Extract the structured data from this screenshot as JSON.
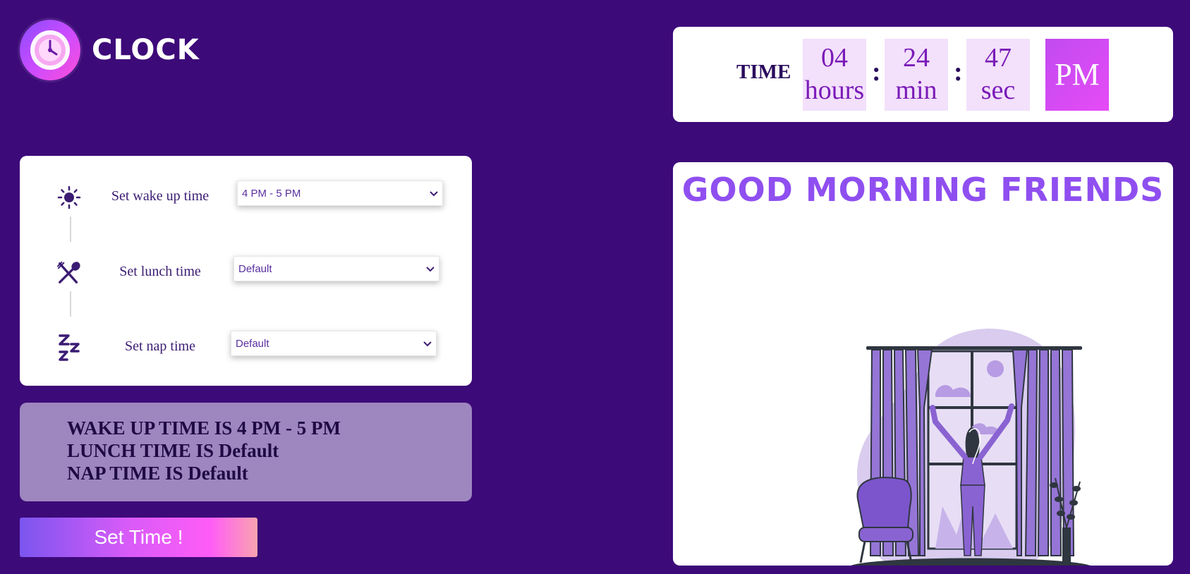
{
  "app": {
    "title": "CLOCK"
  },
  "time": {
    "label": "TIME",
    "hours": {
      "value": "04",
      "unit": "hours"
    },
    "minutes": {
      "value": "24",
      "unit": "min"
    },
    "seconds": {
      "value": "47",
      "unit": "sec"
    },
    "separator": ":",
    "period": "PM"
  },
  "settings": {
    "wake": {
      "label": "Set wake up time",
      "selected": "4 PM - 5 PM",
      "icon": "sun-icon"
    },
    "lunch": {
      "label": "Set lunch time",
      "selected": "Default",
      "icon": "fork-spoon-icon"
    },
    "nap": {
      "label": "Set nap time",
      "selected": "Default",
      "icon": "zzz-icon"
    }
  },
  "summary": {
    "wake_line": "WAKE UP TIME IS 4 PM - 5 PM",
    "lunch_line": "LUNCH TIME IS Default",
    "nap_line": "NAP TIME IS Default"
  },
  "button": {
    "set_time_label": "Set Time !"
  },
  "greeting": {
    "title": "GOOD MORNING FRIENDS"
  },
  "colors": {
    "background": "#3d0a79",
    "accent_purple": "#8f4ff0",
    "time_box": "#f3e0fb",
    "summary_bg": "#9e86bf"
  }
}
